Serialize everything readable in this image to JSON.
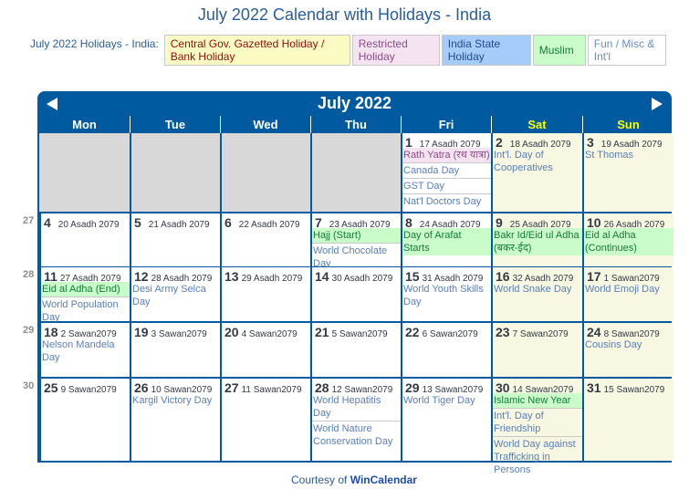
{
  "page": {
    "title": "July 2022 Calendar with Holidays - India"
  },
  "legend": {
    "label": "July 2022 Holidays - India:",
    "items": [
      {
        "key": "gov",
        "label": "Central Gov. Gazetted Holiday / Bank Holiday",
        "bg": "#fdfbc4",
        "color": "#8b1010"
      },
      {
        "key": "res",
        "label": "Restricted Holiday",
        "bg": "#f5e3f2",
        "color": "#8a4d84"
      },
      {
        "key": "state",
        "label": "India State Holiday",
        "bg": "#a6ccfb",
        "color": "#1f4c8c"
      },
      {
        "key": "muslim",
        "label": "Muslim",
        "bg": "#c9fcc8",
        "color": "#157a3c"
      },
      {
        "key": "fun",
        "label": "Fun / Misc & Int'l",
        "bg": "#ffffff",
        "color": "#6a8fc0"
      }
    ]
  },
  "calendar": {
    "month_label": "July 2022",
    "prev_icon": "triangle-left-icon",
    "next_icon": "triangle-right-icon",
    "weekdays": [
      "Mon",
      "Tue",
      "Wed",
      "Thu",
      "Fri",
      "Sat",
      "Sun"
    ],
    "weekend_color": "#ffff00",
    "header_color": "#005aa0",
    "weeks": [
      {
        "week_number": "",
        "days": [
          {
            "empty": true
          },
          {
            "empty": true
          },
          {
            "empty": true
          },
          {
            "empty": true
          },
          {
            "day": "1",
            "sub": "17 Asadh 2079",
            "events": [
              {
                "text": "Rath Yatra (रथ यात्रा)",
                "type": "res"
              },
              {
                "text": "Canada Day",
                "type": "fun"
              },
              {
                "text": "GST Day",
                "type": "fun"
              },
              {
                "text": "Nat'l Doctors Day",
                "type": "fun"
              }
            ]
          },
          {
            "day": "2",
            "sub": "18 Asadh 2079",
            "weekend": true,
            "events": [
              {
                "text": "Int'l. Day of Cooperatives",
                "type": "fun"
              }
            ]
          },
          {
            "day": "3",
            "sub": "19 Asadh 2079",
            "weekend": true,
            "events": [
              {
                "text": "St Thomas",
                "type": "fun"
              }
            ]
          }
        ]
      },
      {
        "week_number": "27",
        "days": [
          {
            "day": "4",
            "sub": "20 Asadh 2079",
            "events": []
          },
          {
            "day": "5",
            "sub": "21 Asadh 2079",
            "events": []
          },
          {
            "day": "6",
            "sub": "22 Asadh 2079",
            "events": []
          },
          {
            "day": "7",
            "sub": "23 Asadh 2079",
            "events": [
              {
                "text": "Hajj (Start)",
                "type": "muslim"
              },
              {
                "text": "World Chocolate Day",
                "type": "fun"
              }
            ]
          },
          {
            "day": "8",
            "sub": "24 Asadh 2079",
            "events": [
              {
                "text": "Day of Arafat Starts",
                "type": "muslim"
              }
            ]
          },
          {
            "day": "9",
            "sub": "25 Asadh 2079",
            "weekend": true,
            "events": [
              {
                "text": "Bakr Id/Eid ul Adha (बकर-ईद)",
                "type": "muslim"
              }
            ]
          },
          {
            "day": "10",
            "sub": "26 Asadh 2079",
            "weekend": true,
            "events": [
              {
                "text": "Eid al Adha (Continues)",
                "type": "muslim"
              }
            ]
          }
        ]
      },
      {
        "week_number": "28",
        "days": [
          {
            "day": "11",
            "sub": "27 Asadh 2079",
            "events": [
              {
                "text": "Eid al Adha (End)",
                "type": "muslim"
              },
              {
                "text": "World Population Day",
                "type": "fun"
              }
            ]
          },
          {
            "day": "12",
            "sub": "28 Asadh 2079",
            "events": [
              {
                "text": "Desi Army Selca Day",
                "type": "fun"
              }
            ]
          },
          {
            "day": "13",
            "sub": "29 Asadh 2079",
            "events": []
          },
          {
            "day": "14",
            "sub": "30 Asadh 2079",
            "events": []
          },
          {
            "day": "15",
            "sub": "31 Asadh 2079",
            "events": [
              {
                "text": "World Youth Skills Day",
                "type": "fun"
              }
            ]
          },
          {
            "day": "16",
            "sub": "32 Asadh 2079",
            "weekend": true,
            "events": [
              {
                "text": "World Snake Day",
                "type": "fun"
              }
            ]
          },
          {
            "day": "17",
            "sub": "1 Sawan2079",
            "weekend": true,
            "events": [
              {
                "text": "World Emoji Day",
                "type": "fun"
              }
            ]
          }
        ]
      },
      {
        "week_number": "29",
        "days": [
          {
            "day": "18",
            "sub": "2 Sawan2079",
            "events": [
              {
                "text": "Nelson Mandela Day",
                "type": "fun"
              }
            ]
          },
          {
            "day": "19",
            "sub": "3 Sawan2079",
            "events": []
          },
          {
            "day": "20",
            "sub": "4 Sawan2079",
            "events": []
          },
          {
            "day": "21",
            "sub": "5 Sawan2079",
            "events": []
          },
          {
            "day": "22",
            "sub": "6 Sawan2079",
            "events": []
          },
          {
            "day": "23",
            "sub": "7 Sawan2079",
            "weekend": true,
            "events": []
          },
          {
            "day": "24",
            "sub": "8 Sawan2079",
            "weekend": true,
            "events": [
              {
                "text": "Cousins Day",
                "type": "fun"
              }
            ]
          }
        ]
      },
      {
        "week_number": "30",
        "days": [
          {
            "day": "25",
            "sub": "9 Sawan2079",
            "events": []
          },
          {
            "day": "26",
            "sub": "10 Sawan2079",
            "events": [
              {
                "text": "Kargil Victory Day",
                "type": "fun"
              }
            ]
          },
          {
            "day": "27",
            "sub": "11 Sawan2079",
            "events": []
          },
          {
            "day": "28",
            "sub": "12 Sawan2079",
            "events": [
              {
                "text": "World Hepatitis Day",
                "type": "fun"
              },
              {
                "text": "World Nature Conservation Day",
                "type": "fun"
              }
            ]
          },
          {
            "day": "29",
            "sub": "13 Sawan2079",
            "events": [
              {
                "text": "World Tiger Day",
                "type": "fun"
              }
            ]
          },
          {
            "day": "30",
            "sub": "14 Sawan2079",
            "weekend": true,
            "events": [
              {
                "text": "Islamic New Year",
                "type": "muslim"
              },
              {
                "text": "Int'l. Day of Friendship",
                "type": "fun"
              },
              {
                "text": "World Day against Trafficking in Persons",
                "type": "fun"
              }
            ]
          },
          {
            "day": "31",
            "sub": "15 Sawan2079",
            "weekend": true,
            "events": []
          }
        ]
      }
    ]
  },
  "footer": {
    "prefix": "Courtesy of",
    "link": "WinCalendar"
  }
}
